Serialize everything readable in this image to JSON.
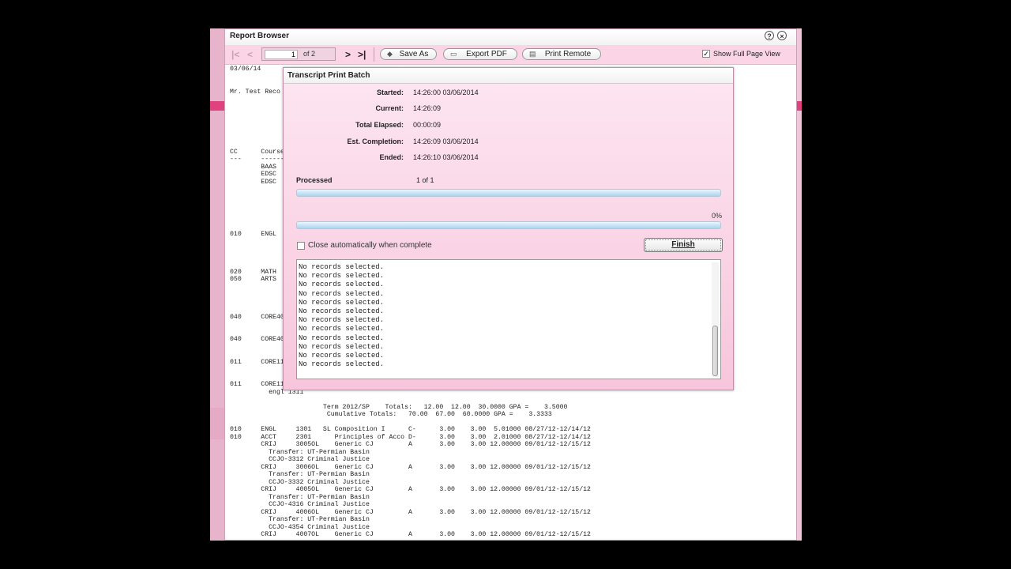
{
  "report_browser": {
    "title": "Report Browser",
    "help_icon": "?",
    "close_icon": "×",
    "toolbar": {
      "first_icon": "|<",
      "prev_icon": "<",
      "page_value": "1",
      "page_of": "of 2",
      "next_icon": ">",
      "last_icon": ">|",
      "save_as": "Save As",
      "export_pdf": "Export PDF",
      "print_remote": "Print Remote",
      "show_full_page": "Show Full Page View",
      "show_full_page_checked": "✓"
    },
    "document_text": "03/06/14\n\n\nMr. Test Reco\n\n\n\n\n\n\n\nCC      Course\n---     ------\n        BAAS\n        EDSC\n        EDSC\n\n\n\n\n\n\n010     ENGL\n\n\n\n\n020     MATH\n050     ARTS\n\n\n\n\n040     CORE40\n\n\n040     CORE40\n\n\n011     CORE11\n\n\n011     CORE11\n          engl 1311\n\n                        Term 2012/SP    Totals:   12.00  12.00  30.0000 GPA =    3.5000\n                         Cumulative Totals:   70.00  67.00  60.0000 GPA =    3.3333\n\n010     ENGL     1301   SL Composition I      C-      3.00    3.00  5.01000 08/27/12-12/14/12\n010     ACCT     2301      Principles of Acco D-      3.00    3.00  2.01000 08/27/12-12/14/12\n        CRIJ     3005OL    Generic CJ         A       3.00    3.00 12.00000 09/01/12-12/15/12\n          Transfer: UT-Permian Basin\n          CCJO-3312 Criminal Justice\n        CRIJ     3006OL    Generic CJ         A       3.00    3.00 12.00000 09/01/12-12/15/12\n          Transfer: UT-Permian Basin\n          CCJO-3332 Criminal Justice\n        CRIJ     4005OL    Generic CJ         A       3.00    3.00 12.00000 09/01/12-12/15/12\n          Transfer: UT-Permian Basin\n          CCJO-4316 Criminal Justice\n        CRIJ     4006OL    Generic CJ         A       3.00    3.00 12.00000 09/01/12-12/15/12\n          Transfer: UT-Permian Basin\n          CCJO-4354 Criminal Justice\n        CRIJ     4007OL    Generic CJ         A       3.00    3.00 12.00000 09/01/12-12/15/12"
  },
  "dialog": {
    "title": "Transcript Print Batch",
    "rows": [
      {
        "label": "Started:",
        "value": "14:26:00  03/06/2014"
      },
      {
        "label": "Current:",
        "value": "14:26:09"
      },
      {
        "label": "Total Elapsed:",
        "value": "00:00:09"
      },
      {
        "label": "Est. Completion:",
        "value": "14:26:09  03/06/2014"
      },
      {
        "label": "Ended:",
        "value": "14:26:10  03/06/2014"
      }
    ],
    "processed_label": "Processed",
    "processed_value": "1   of   1",
    "processed_fraction": 1.0,
    "second_progress_fraction": 1.0,
    "percent_text": "0%",
    "close_auto_label": "Close automatically when complete",
    "finish_label": "Finish",
    "log_lines": [
      "No records selected.",
      "No records selected.",
      "No records selected.",
      "No records selected.",
      "No records selected.",
      "No records selected.",
      "No records selected.",
      "No records selected.",
      "No records selected.",
      "No records selected.",
      "No records selected.",
      "No records selected."
    ]
  },
  "colors": {
    "accent_pink": "#e0417f",
    "toolbar_pink": "#fbd4e5",
    "dialog_pink": "#f7c6dc",
    "progress_blue": "#a9d4ee"
  }
}
